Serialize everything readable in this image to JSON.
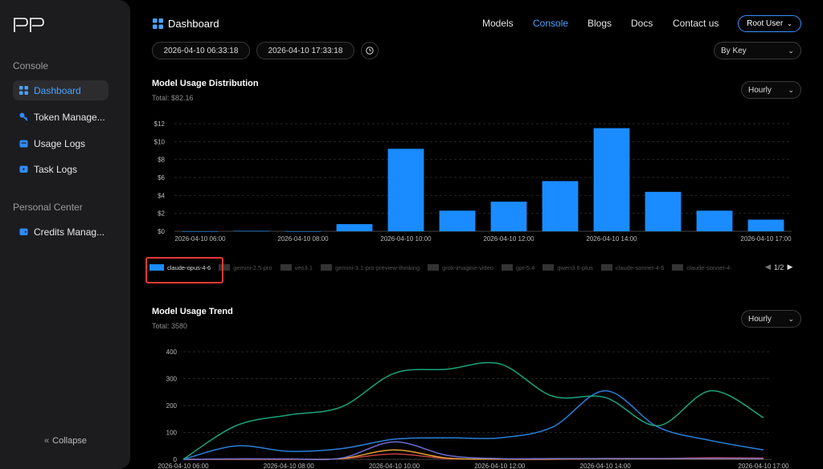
{
  "sidebar": {
    "section_console": "Console",
    "items": [
      {
        "label": "Dashboard",
        "icon": "grid-icon"
      },
      {
        "label": "Token Manage...",
        "icon": "key-icon"
      },
      {
        "label": "Usage Logs",
        "icon": "calendar-icon"
      },
      {
        "label": "Task Logs",
        "icon": "video-icon"
      }
    ],
    "section_personal": "Personal Center",
    "personal_items": [
      {
        "label": "Credits Manag...",
        "icon": "wallet-icon"
      }
    ],
    "collapse": "Collapse"
  },
  "header": {
    "title": "Dashboard",
    "nav": [
      "Models",
      "Console",
      "Blogs",
      "Docs",
      "Contact us"
    ],
    "active_nav": "Console",
    "user": "Root User"
  },
  "filters": {
    "start": "2026-04-10 06:33:18",
    "end": "2026-04-10 17:33:18",
    "group_by": "By Key"
  },
  "distribution": {
    "title": "Model Usage Distribution",
    "total": "Total: $82.16",
    "interval": "Hourly",
    "legend": [
      "claude-opus-4-6",
      "gemini-2.5-pro",
      "veo3.1",
      "gemini-3.1-pro-preview-thinking",
      "grok-imagine-video",
      "gpt-5.4",
      "qwen3.6-plus",
      "claude-sonnet-4-6",
      "claude-sonnet-4-"
    ],
    "selected_legend": "claude-opus-4-6",
    "pager": "1/2"
  },
  "trend": {
    "title": "Model Usage Trend",
    "total": "Total: 3580",
    "interval": "Hourly"
  },
  "colors": {
    "accent": "#4aa3ff",
    "bar": "#1a8cff",
    "highlight": "#e53935"
  },
  "chart_data": [
    {
      "type": "bar",
      "title": "Model Usage Distribution",
      "categories": [
        "2026-04-10 06:00",
        "2026-04-10 07:00",
        "2026-04-10 08:00",
        "2026-04-10 09:00",
        "2026-04-10 10:00",
        "2026-04-10 11:00",
        "2026-04-10 12:00",
        "2026-04-10 13:00",
        "2026-04-10 14:00",
        "2026-04-10 15:00",
        "2026-04-10 16:00",
        "2026-04-10 17:00"
      ],
      "x_tick_labels": [
        "2026-04-10 06:00",
        "2026-04-10 08:00",
        "2026-04-10 10:00",
        "2026-04-10 12:00",
        "2026-04-10 14:00",
        "2026-04-10 17:00"
      ],
      "values": [
        0,
        0.05,
        0,
        0.8,
        9.2,
        2.3,
        3.3,
        5.6,
        11.5,
        4.4,
        2.3,
        1.3
      ],
      "ylim": [
        0,
        12
      ],
      "y_ticks": [
        "$0",
        "$2",
        "$4",
        "$6",
        "$8",
        "$10",
        "$12"
      ],
      "grid": true
    },
    {
      "type": "line",
      "title": "Model Usage Trend",
      "x": [
        "2026-04-10 06:00",
        "2026-04-10 07:00",
        "2026-04-10 08:00",
        "2026-04-10 09:00",
        "2026-04-10 10:00",
        "2026-04-10 11:00",
        "2026-04-10 12:00",
        "2026-04-10 13:00",
        "2026-04-10 14:00",
        "2026-04-10 15:00",
        "2026-04-10 16:00",
        "2026-04-10 17:00"
      ],
      "x_tick_labels": [
        "2026-04-10 06:00",
        "2026-04-10 08:00",
        "2026-04-10 10:00",
        "2026-04-10 12:00",
        "2026-04-10 14:00",
        "2026-04-10 17:00"
      ],
      "ylim": [
        0,
        400
      ],
      "y_ticks": [
        "0",
        "100",
        "200",
        "300",
        "400"
      ],
      "series": [
        {
          "color": "#1aa37a",
          "values": [
            0,
            125,
            165,
            195,
            320,
            335,
            355,
            235,
            230,
            125,
            255,
            155
          ]
        },
        {
          "color": "#2a7fd8",
          "values": [
            0,
            50,
            30,
            40,
            75,
            80,
            80,
            120,
            255,
            120,
            70,
            35
          ]
        },
        {
          "color": "#6b6bd0",
          "values": [
            0,
            2,
            2,
            5,
            65,
            15,
            3,
            3,
            3,
            3,
            3,
            3
          ]
        },
        {
          "color": "#e0a030",
          "values": [
            0,
            1,
            1,
            3,
            35,
            5,
            1,
            1,
            2,
            2,
            2,
            2
          ]
        },
        {
          "color": "#c04040",
          "values": [
            0,
            0,
            0,
            2,
            20,
            3,
            0,
            0,
            3,
            3,
            6,
            5
          ]
        }
      ],
      "grid": true
    }
  ]
}
